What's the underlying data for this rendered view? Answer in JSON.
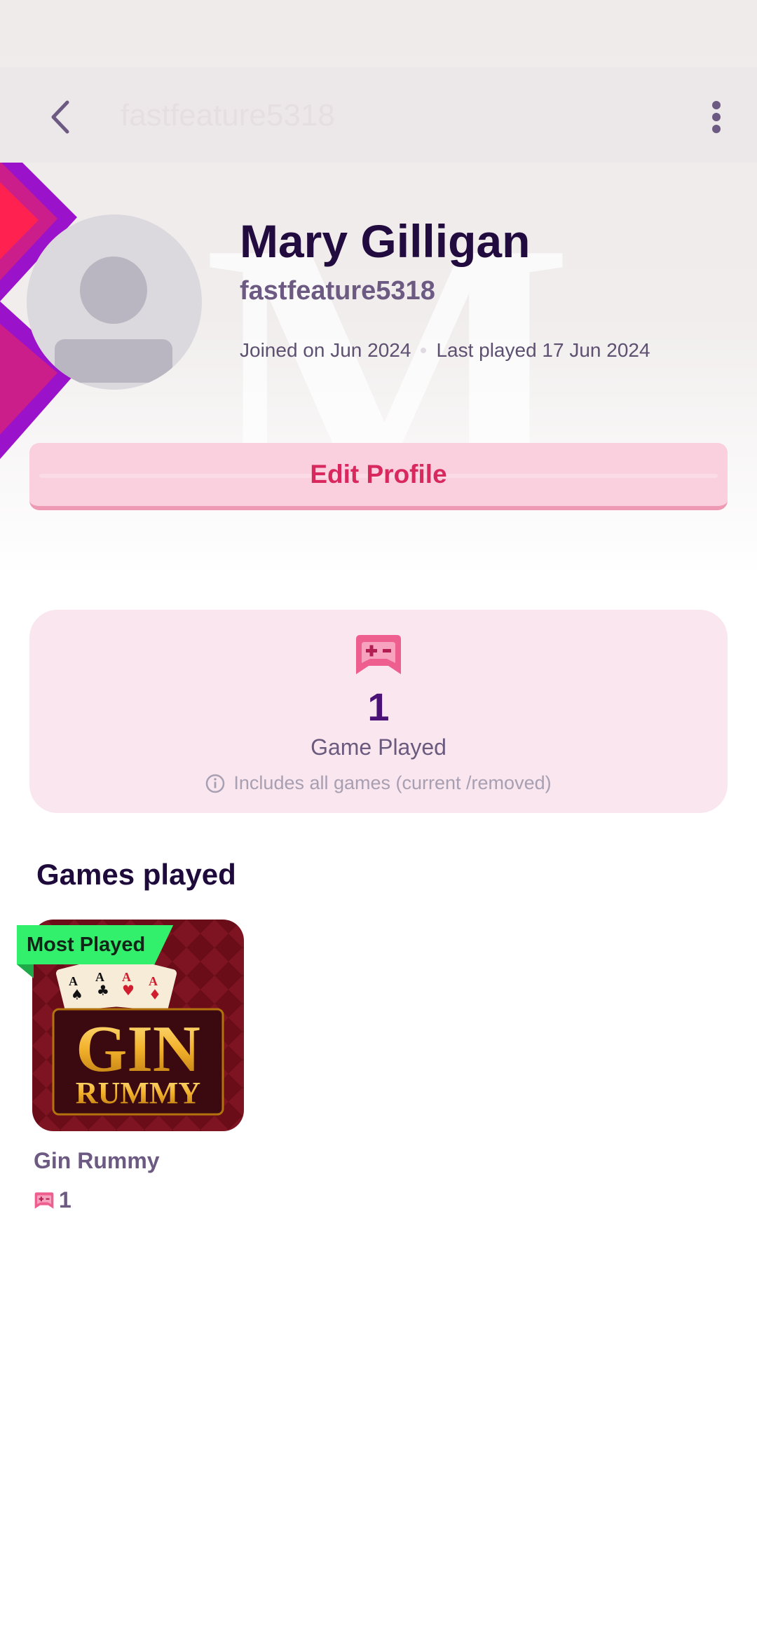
{
  "topbar": {
    "title": "fastfeature5318"
  },
  "profile": {
    "name": "Mary Gilligan",
    "username": "fastfeature5318",
    "joined": "Joined on Jun 2024",
    "last_played": "Last played 17 Jun 2024",
    "watermark_letter": "M"
  },
  "edit_button": {
    "label": "Edit Profile"
  },
  "stats": {
    "count": "1",
    "label": "Game Played",
    "note": "Includes all games (current /removed)"
  },
  "games_section": {
    "title": "Games played",
    "games": [
      {
        "name": "Gin Rummy",
        "badge": "Most Played",
        "plays": "1",
        "art_title_line1": "GIN",
        "art_title_line2": "RUMMY"
      }
    ]
  },
  "colors": {
    "accent_pink": "#d8285e",
    "title_purple": "#220b3f",
    "badge_green": "#33f06c"
  },
  "icons": [
    "back-arrow-icon",
    "more-vertical-icon",
    "gamepad-icon",
    "info-icon"
  ]
}
